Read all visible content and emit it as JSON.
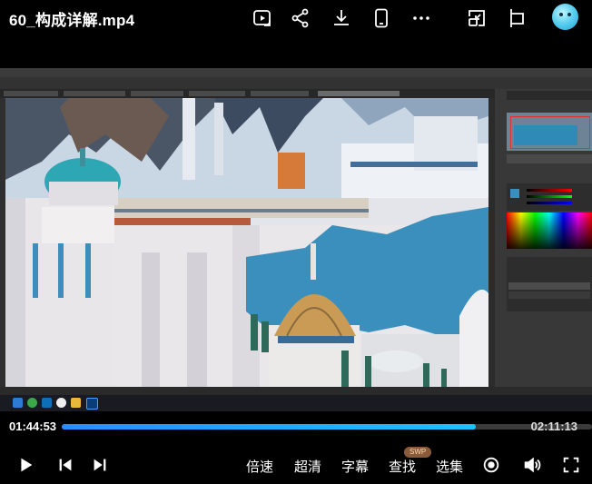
{
  "video": {
    "title": "60_构成详解.mp4",
    "current_time": "01:44:53",
    "total_time": "02:11:13",
    "progress": 0.78
  },
  "header_icons": [
    "picture-in-picture-play-icon",
    "share-icon",
    "download-icon",
    "mobile-phone-icon",
    "more-icon",
    "mini-window-icon",
    "pin-icon"
  ],
  "controls": {
    "speed_label": "倍速",
    "quality_label": "超清",
    "subtitle_label": "字幕",
    "search_label": "查找",
    "search_badge": "SWP",
    "episodes_label": "选集"
  },
  "colors": {
    "accent": "#1ea0ff",
    "background": "#000000"
  }
}
